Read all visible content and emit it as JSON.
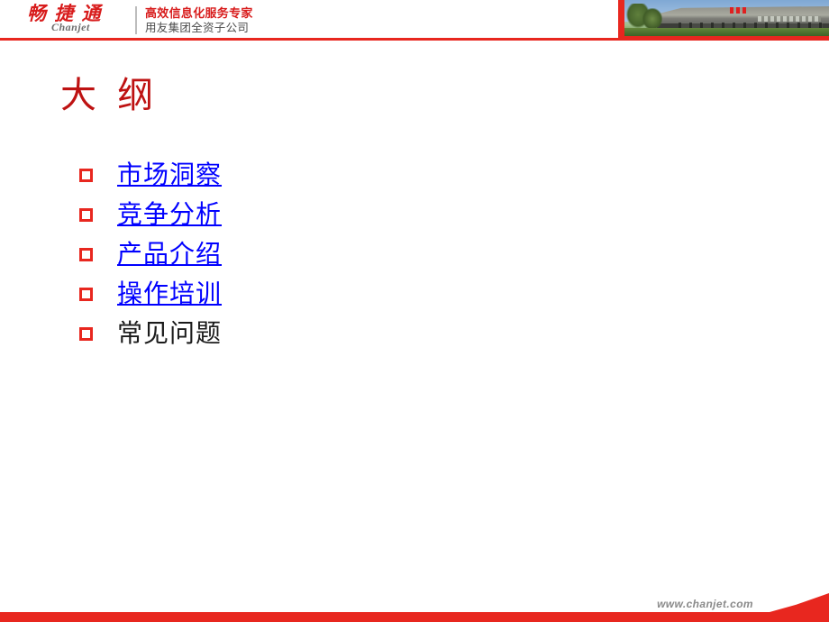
{
  "slide": {
    "title": "大 纲",
    "title_color": "#BE1212",
    "background_color": "#FFFFFF"
  },
  "header": {
    "logo": {
      "name_cn": "畅 捷 通",
      "name_en": "Chanjet",
      "name_cn_color": "#D81C1C",
      "name_en_color": "#6E6E6E"
    },
    "tagline": {
      "line1": "高效信息化服务专家",
      "line2": "用友集团全资子公司",
      "line1_color": "#D81C1C",
      "line2_color": "#4A4A4A"
    },
    "photo": {
      "icon": "campus-building-photo",
      "border_color": "#E8271F"
    },
    "rule_color": "#E8271F"
  },
  "outline": {
    "bullet_icon": "hollow-square-bullet",
    "bullet_color": "#E8271F",
    "link_color": "#0000FF",
    "plain_color": "#1A1A1A",
    "items": [
      {
        "label": "市场洞察",
        "style": "link"
      },
      {
        "label": "竞争分析",
        "style": "link"
      },
      {
        "label": "产品介绍",
        "style": "link"
      },
      {
        "label": "操作培训",
        "style": "link"
      },
      {
        "label": "常见问题",
        "style": "plain"
      }
    ]
  },
  "footer": {
    "url": "www.chanjet.com",
    "url_color": "#8A8A8A",
    "bar_color": "#E8271F"
  }
}
